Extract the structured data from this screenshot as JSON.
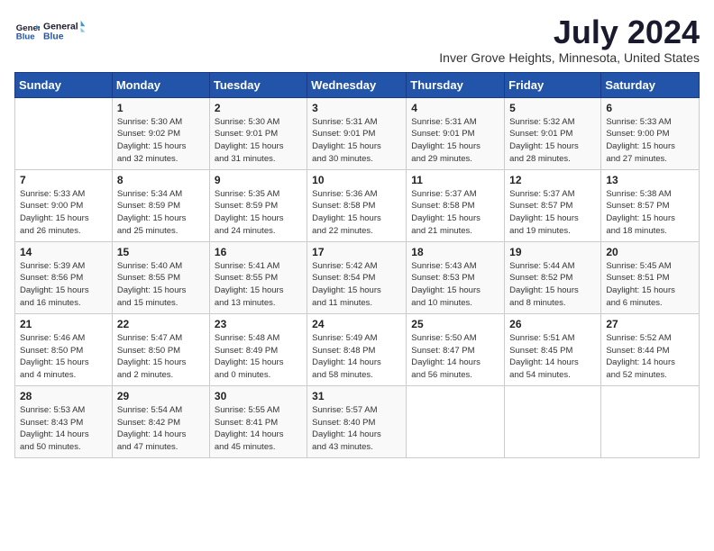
{
  "header": {
    "logo_general": "General",
    "logo_blue": "Blue",
    "month_title": "July 2024",
    "location": "Inver Grove Heights, Minnesota, United States"
  },
  "days_of_week": [
    "Sunday",
    "Monday",
    "Tuesday",
    "Wednesday",
    "Thursday",
    "Friday",
    "Saturday"
  ],
  "weeks": [
    [
      {
        "day": "",
        "info": ""
      },
      {
        "day": "1",
        "info": "Sunrise: 5:30 AM\nSunset: 9:02 PM\nDaylight: 15 hours\nand 32 minutes."
      },
      {
        "day": "2",
        "info": "Sunrise: 5:30 AM\nSunset: 9:01 PM\nDaylight: 15 hours\nand 31 minutes."
      },
      {
        "day": "3",
        "info": "Sunrise: 5:31 AM\nSunset: 9:01 PM\nDaylight: 15 hours\nand 30 minutes."
      },
      {
        "day": "4",
        "info": "Sunrise: 5:31 AM\nSunset: 9:01 PM\nDaylight: 15 hours\nand 29 minutes."
      },
      {
        "day": "5",
        "info": "Sunrise: 5:32 AM\nSunset: 9:01 PM\nDaylight: 15 hours\nand 28 minutes."
      },
      {
        "day": "6",
        "info": "Sunrise: 5:33 AM\nSunset: 9:00 PM\nDaylight: 15 hours\nand 27 minutes."
      }
    ],
    [
      {
        "day": "7",
        "info": "Sunrise: 5:33 AM\nSunset: 9:00 PM\nDaylight: 15 hours\nand 26 minutes."
      },
      {
        "day": "8",
        "info": "Sunrise: 5:34 AM\nSunset: 8:59 PM\nDaylight: 15 hours\nand 25 minutes."
      },
      {
        "day": "9",
        "info": "Sunrise: 5:35 AM\nSunset: 8:59 PM\nDaylight: 15 hours\nand 24 minutes."
      },
      {
        "day": "10",
        "info": "Sunrise: 5:36 AM\nSunset: 8:58 PM\nDaylight: 15 hours\nand 22 minutes."
      },
      {
        "day": "11",
        "info": "Sunrise: 5:37 AM\nSunset: 8:58 PM\nDaylight: 15 hours\nand 21 minutes."
      },
      {
        "day": "12",
        "info": "Sunrise: 5:37 AM\nSunset: 8:57 PM\nDaylight: 15 hours\nand 19 minutes."
      },
      {
        "day": "13",
        "info": "Sunrise: 5:38 AM\nSunset: 8:57 PM\nDaylight: 15 hours\nand 18 minutes."
      }
    ],
    [
      {
        "day": "14",
        "info": "Sunrise: 5:39 AM\nSunset: 8:56 PM\nDaylight: 15 hours\nand 16 minutes."
      },
      {
        "day": "15",
        "info": "Sunrise: 5:40 AM\nSunset: 8:55 PM\nDaylight: 15 hours\nand 15 minutes."
      },
      {
        "day": "16",
        "info": "Sunrise: 5:41 AM\nSunset: 8:55 PM\nDaylight: 15 hours\nand 13 minutes."
      },
      {
        "day": "17",
        "info": "Sunrise: 5:42 AM\nSunset: 8:54 PM\nDaylight: 15 hours\nand 11 minutes."
      },
      {
        "day": "18",
        "info": "Sunrise: 5:43 AM\nSunset: 8:53 PM\nDaylight: 15 hours\nand 10 minutes."
      },
      {
        "day": "19",
        "info": "Sunrise: 5:44 AM\nSunset: 8:52 PM\nDaylight: 15 hours\nand 8 minutes."
      },
      {
        "day": "20",
        "info": "Sunrise: 5:45 AM\nSunset: 8:51 PM\nDaylight: 15 hours\nand 6 minutes."
      }
    ],
    [
      {
        "day": "21",
        "info": "Sunrise: 5:46 AM\nSunset: 8:50 PM\nDaylight: 15 hours\nand 4 minutes."
      },
      {
        "day": "22",
        "info": "Sunrise: 5:47 AM\nSunset: 8:50 PM\nDaylight: 15 hours\nand 2 minutes."
      },
      {
        "day": "23",
        "info": "Sunrise: 5:48 AM\nSunset: 8:49 PM\nDaylight: 15 hours\nand 0 minutes."
      },
      {
        "day": "24",
        "info": "Sunrise: 5:49 AM\nSunset: 8:48 PM\nDaylight: 14 hours\nand 58 minutes."
      },
      {
        "day": "25",
        "info": "Sunrise: 5:50 AM\nSunset: 8:47 PM\nDaylight: 14 hours\nand 56 minutes."
      },
      {
        "day": "26",
        "info": "Sunrise: 5:51 AM\nSunset: 8:45 PM\nDaylight: 14 hours\nand 54 minutes."
      },
      {
        "day": "27",
        "info": "Sunrise: 5:52 AM\nSunset: 8:44 PM\nDaylight: 14 hours\nand 52 minutes."
      }
    ],
    [
      {
        "day": "28",
        "info": "Sunrise: 5:53 AM\nSunset: 8:43 PM\nDaylight: 14 hours\nand 50 minutes."
      },
      {
        "day": "29",
        "info": "Sunrise: 5:54 AM\nSunset: 8:42 PM\nDaylight: 14 hours\nand 47 minutes."
      },
      {
        "day": "30",
        "info": "Sunrise: 5:55 AM\nSunset: 8:41 PM\nDaylight: 14 hours\nand 45 minutes."
      },
      {
        "day": "31",
        "info": "Sunrise: 5:57 AM\nSunset: 8:40 PM\nDaylight: 14 hours\nand 43 minutes."
      },
      {
        "day": "",
        "info": ""
      },
      {
        "day": "",
        "info": ""
      },
      {
        "day": "",
        "info": ""
      }
    ]
  ]
}
